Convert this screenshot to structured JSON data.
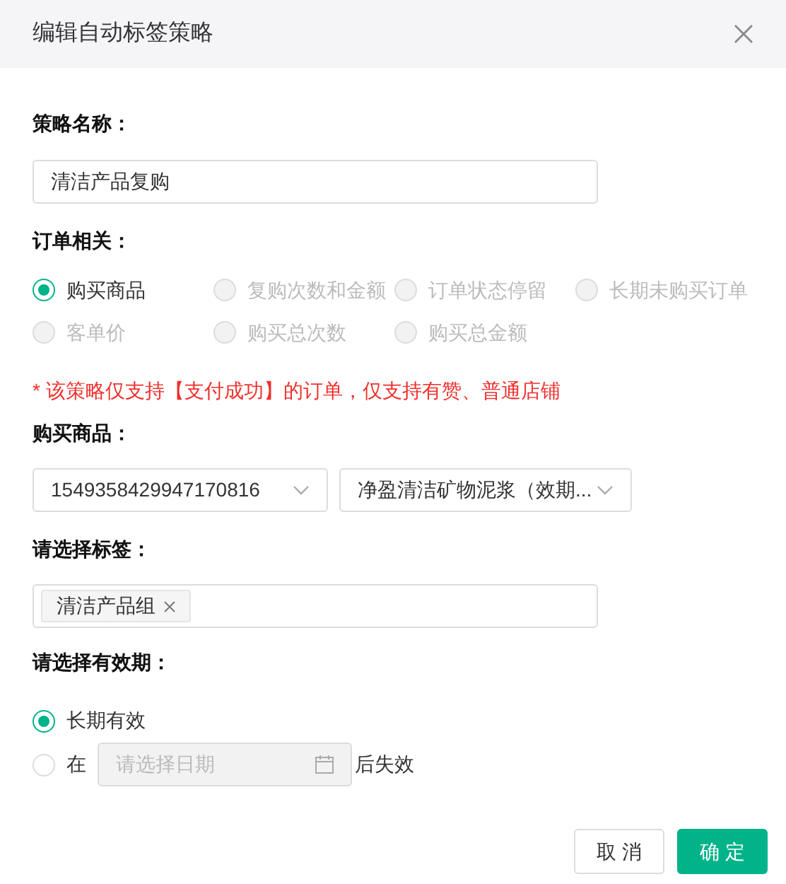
{
  "dialog": {
    "title": "编辑自动标签策略"
  },
  "strategy_name": {
    "label": "策略名称：",
    "value": "清洁产品复购"
  },
  "order_related": {
    "label": "订单相关：",
    "options": [
      {
        "label": "购买商品",
        "selected": true,
        "disabled": false
      },
      {
        "label": "复购次数和金额",
        "selected": false,
        "disabled": true
      },
      {
        "label": "订单状态停留",
        "selected": false,
        "disabled": true
      },
      {
        "label": "长期未购买订单",
        "selected": false,
        "disabled": true
      },
      {
        "label": "客单价",
        "selected": false,
        "disabled": true
      },
      {
        "label": "购买总次数",
        "selected": false,
        "disabled": true
      },
      {
        "label": "购买总金额",
        "selected": false,
        "disabled": true
      }
    ]
  },
  "notice": "* 该策略仅支持【支付成功】的订单，仅支持有赞、普通店铺",
  "products": {
    "label": "购买商品：",
    "selects": [
      {
        "value": "1549358429947170816"
      },
      {
        "value": "净盈清洁矿物泥浆（效期..."
      }
    ]
  },
  "tags": {
    "label": "请选择标签：",
    "items": [
      {
        "text": "清洁产品组"
      }
    ]
  },
  "validity": {
    "label": "请选择有效期：",
    "options": [
      {
        "kind": "plain",
        "label": "长期有效",
        "selected": true
      },
      {
        "kind": "date",
        "label": "在",
        "placeholder": "请选择日期",
        "suffix": "后失效",
        "selected": false,
        "disabled": true
      }
    ]
  },
  "buttons": [
    {
      "label": "取 消",
      "primary": false
    },
    {
      "label": "确 定",
      "primary": true
    }
  ]
}
